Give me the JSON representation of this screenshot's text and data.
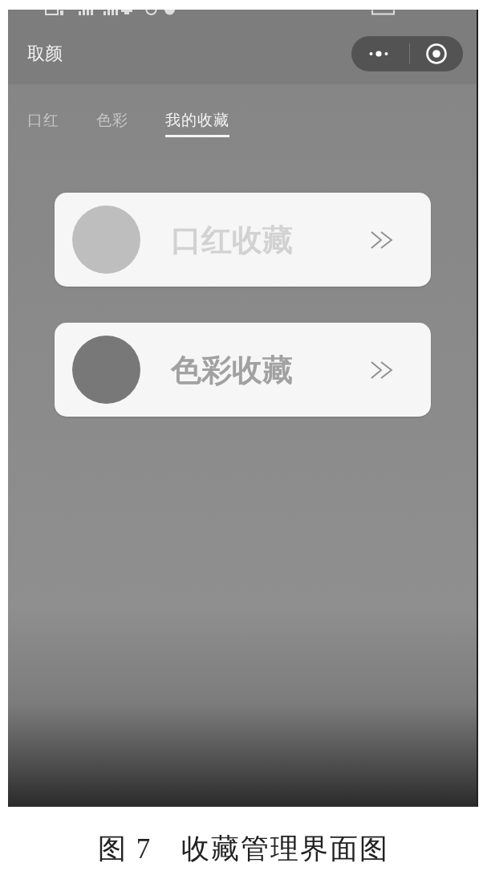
{
  "header": {
    "title": "取颜"
  },
  "tabs": [
    {
      "label": "口红",
      "selected": false
    },
    {
      "label": "色彩",
      "selected": false
    },
    {
      "label": "我的收藏",
      "selected": true
    }
  ],
  "cards": [
    {
      "label": "口红收藏",
      "color": "#bebebe"
    },
    {
      "label": "色彩收藏",
      "color": "#787878"
    }
  ],
  "caption": {
    "number": "图 7",
    "text": "收藏管理界面图"
  }
}
